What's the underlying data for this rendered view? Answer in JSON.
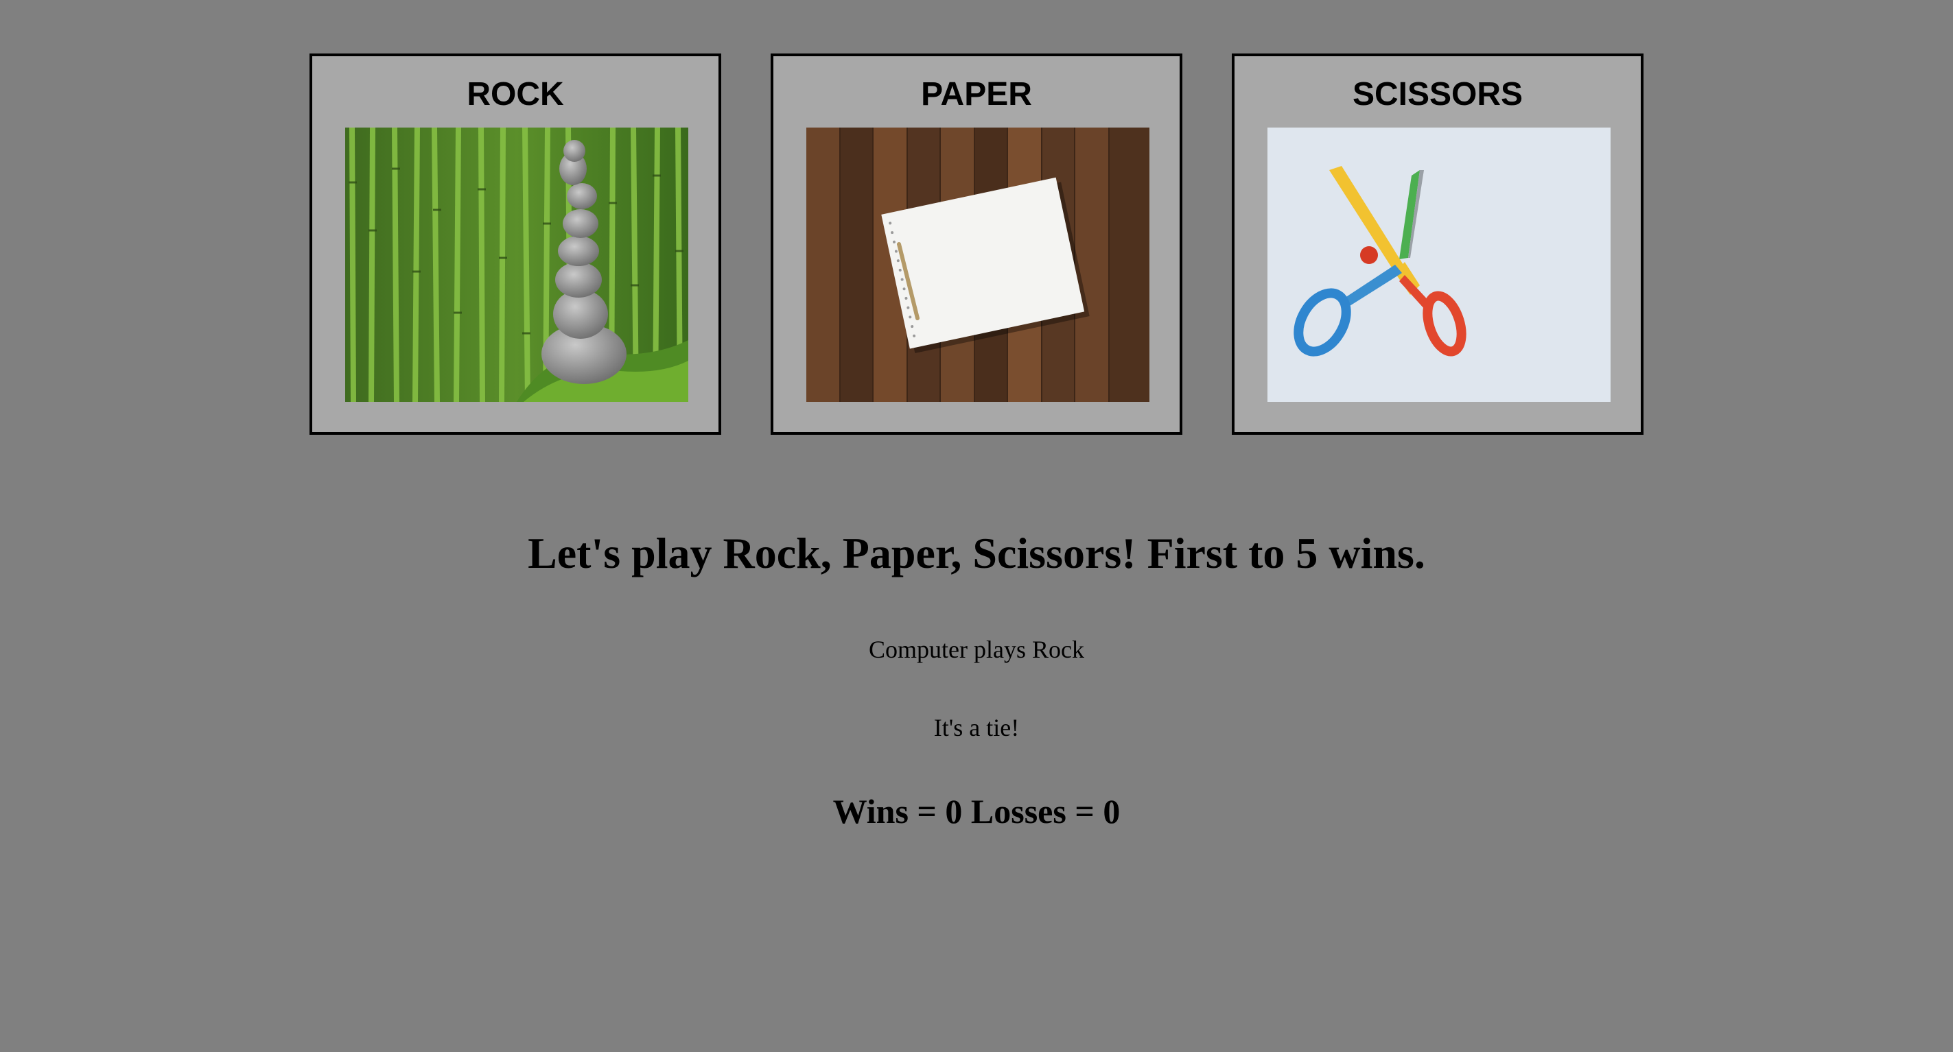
{
  "choices": [
    {
      "label": "ROCK",
      "image": "rock-stack-bamboo-image"
    },
    {
      "label": "PAPER",
      "image": "paper-on-wood-image"
    },
    {
      "label": "SCISSORS",
      "image": "scissors-image"
    }
  ],
  "game": {
    "headline": "Let's play Rock, Paper, Scissors! First to 5 wins.",
    "computer_play": "Computer plays Rock",
    "result": "It's a tie!",
    "score": "Wins = 0 Losses = 0"
  },
  "colors": {
    "background": "#808080",
    "card_background": "#a8a8a8",
    "card_border": "#000000"
  }
}
